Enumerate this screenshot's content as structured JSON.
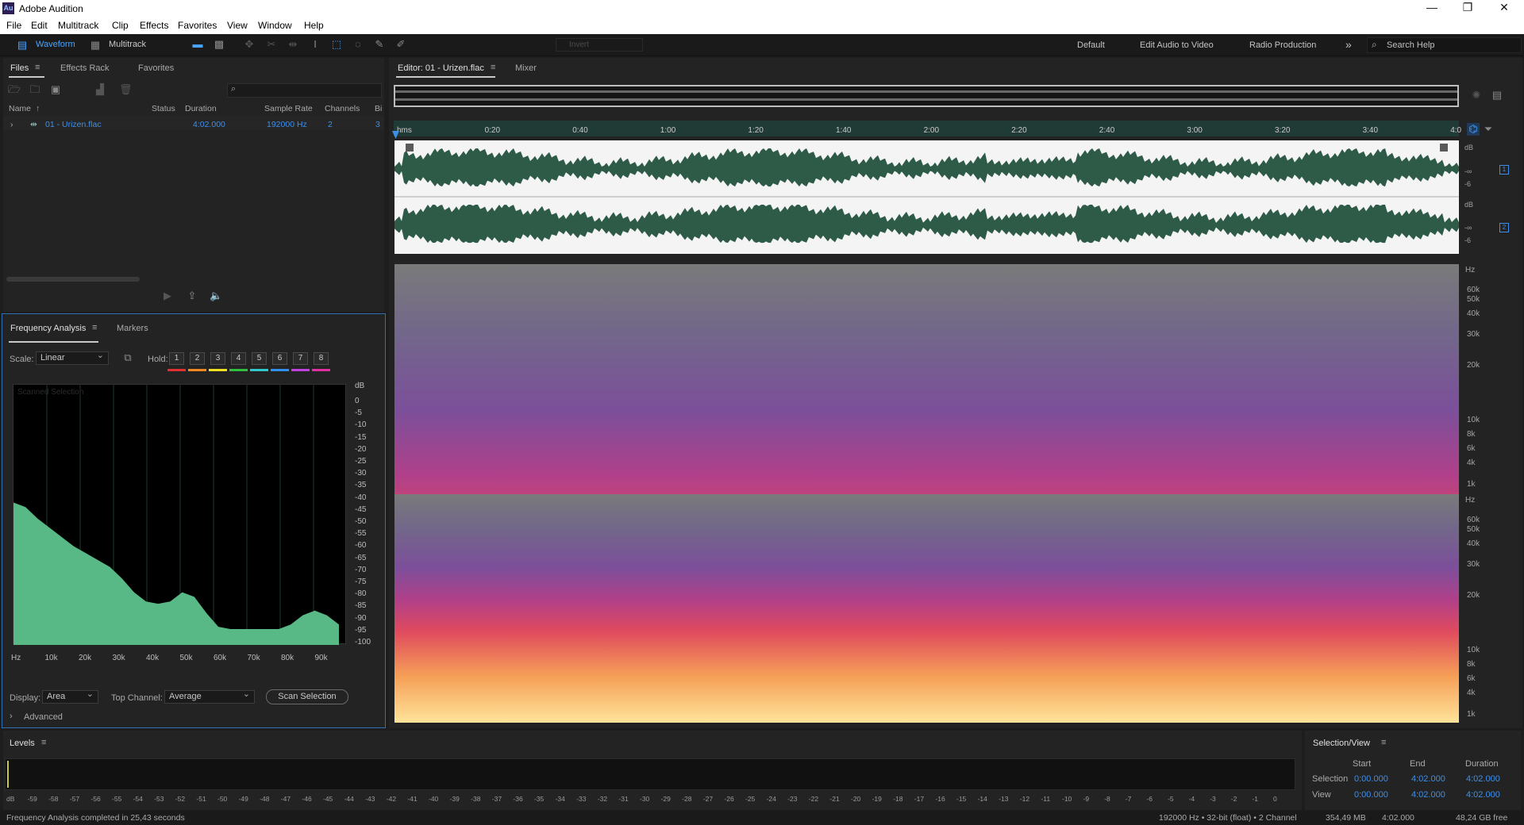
{
  "app": {
    "title": "Adobe Audition",
    "logo": "Au"
  },
  "window_controls": {
    "minimize": "—",
    "maximize": "❐",
    "close": "✕"
  },
  "menu": [
    "File",
    "Edit",
    "Multitrack",
    "Clip",
    "Effects",
    "Favorites",
    "View",
    "Window",
    "Help"
  ],
  "toolbar": {
    "waveform": "Waveform",
    "multitrack": "Multitrack",
    "invert": "Invert",
    "workspaces": [
      "Default",
      "Edit Audio to Video",
      "Radio Production"
    ],
    "more": "»",
    "search_placeholder": "Search Help"
  },
  "files_panel": {
    "tabs": [
      "Files",
      "Effects Rack",
      "Favorites"
    ],
    "columns": [
      "Name",
      "Status",
      "Duration",
      "Sample Rate",
      "Channels",
      "Bi"
    ],
    "rows": [
      {
        "name": "01 - Urizen.flac",
        "status": "",
        "duration": "4:02.000",
        "sample_rate": "192000 Hz",
        "channels": "2",
        "bits": "3"
      }
    ]
  },
  "freq_panel": {
    "tabs": [
      "Frequency Analysis",
      "Markers"
    ],
    "scale_label": "Scale:",
    "scale_value": "Linear",
    "hold_label": "Hold:",
    "hold": [
      "1",
      "2",
      "3",
      "4",
      "5",
      "6",
      "7",
      "8"
    ],
    "hold_colors": [
      "#e03030",
      "#f08a20",
      "#f0e020",
      "#30c040",
      "#30c8c8",
      "#3090f0",
      "#c040e0",
      "#e030a0"
    ],
    "watermark": "Scanned Selection",
    "db_unit": "dB",
    "db_ticks": [
      "0",
      "-5",
      "-10",
      "-15",
      "-20",
      "-25",
      "-30",
      "-35",
      "-40",
      "-45",
      "-50",
      "-55",
      "-60",
      "-65",
      "-70",
      "-75",
      "-80",
      "-85",
      "-90",
      "-95",
      "-100"
    ],
    "hz_ticks": [
      "Hz",
      "10k",
      "20k",
      "30k",
      "40k",
      "50k",
      "60k",
      "70k",
      "80k",
      "90k"
    ],
    "display_label": "Display:",
    "display_value": "Area",
    "top_channel_label": "Top Channel:",
    "top_channel_value": "Average",
    "scan_button": "Scan Selection",
    "advanced": "Advanced"
  },
  "editor": {
    "tab": "Editor: 01 - Urizen.flac",
    "mixer": "Mixer",
    "ruler": [
      "hms",
      "0:20",
      "0:40",
      "1:00",
      "1:20",
      "1:40",
      "2:00",
      "2:20",
      "2:40",
      "3:00",
      "3:20",
      "3:40",
      "4:0"
    ],
    "db_labels": {
      "unit": "dB",
      "inf": "-∞",
      "minus6": "-6"
    },
    "channels": [
      "1",
      "2"
    ],
    "hz_ruler": {
      "unit": "Hz",
      "labels": [
        "60k",
        "50k",
        "40k",
        "30k",
        "20k",
        "10k",
        "8k",
        "6k",
        "4k",
        "1k"
      ]
    }
  },
  "levels": {
    "title": "Levels",
    "scale": [
      "dB",
      "-59",
      "-58",
      "-57",
      "-56",
      "-55",
      "-54",
      "-53",
      "-52",
      "-51",
      "-50",
      "-49",
      "-48",
      "-47",
      "-46",
      "-45",
      "-44",
      "-43",
      "-42",
      "-41",
      "-40",
      "-39",
      "-38",
      "-37",
      "-36",
      "-35",
      "-34",
      "-33",
      "-32",
      "-31",
      "-30",
      "-29",
      "-28",
      "-27",
      "-26",
      "-25",
      "-24",
      "-23",
      "-22",
      "-21",
      "-20",
      "-19",
      "-18",
      "-17",
      "-16",
      "-15",
      "-14",
      "-13",
      "-12",
      "-11",
      "-10",
      "-9",
      "-8",
      "-7",
      "-6",
      "-5",
      "-4",
      "-3",
      "-2",
      "-1",
      "0"
    ]
  },
  "selection_view": {
    "title": "Selection/View",
    "headers": [
      "Start",
      "End",
      "Duration"
    ],
    "selection_label": "Selection",
    "view_label": "View",
    "selection": [
      "0:00.000",
      "4:02.000",
      "4:02.000"
    ],
    "view": [
      "0:00.000",
      "4:02.000",
      "4:02.000"
    ]
  },
  "status": {
    "message": "Frequency Analysis completed in 25,43 seconds",
    "format": "192000 Hz • 32-bit (float) • 2 Channel",
    "size": "354,49 MB",
    "duration": "4:02.000",
    "free": "48,24 GB free"
  },
  "freq_spectrum_db": [
    -45,
    -47,
    -52,
    -56,
    -60,
    -64,
    -67,
    -70,
    -73,
    -78,
    -84,
    -88,
    -89,
    -88,
    -84,
    -86,
    -93,
    -99,
    -100,
    -100,
    -100,
    -100,
    -100,
    -98,
    -94,
    -92,
    -94,
    -98
  ],
  "colors": {
    "accent": "#3f8fe8",
    "waveform": "#2e5a48",
    "spectrum_fill": "#58b886",
    "timeline": "#203a36"
  }
}
